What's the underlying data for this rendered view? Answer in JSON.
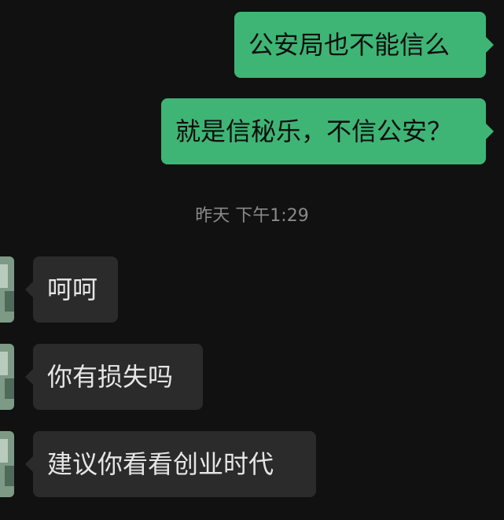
{
  "messages": [
    {
      "from": "me",
      "text": "公安局也不能信么"
    },
    {
      "from": "me",
      "text": "就是信秘乐，不信公安？"
    },
    {
      "from": "system",
      "text": "昨天 下午1:29"
    },
    {
      "from": "other",
      "text": "呵呵"
    },
    {
      "from": "other",
      "text": "你有损失吗"
    },
    {
      "from": "other",
      "text": "建议你看看创业时代"
    }
  ],
  "colors": {
    "background": "#111111",
    "outgoing_bubble": "#3eb575",
    "incoming_bubble": "#2b2b2b",
    "timestamp": "#8a8a8a"
  }
}
